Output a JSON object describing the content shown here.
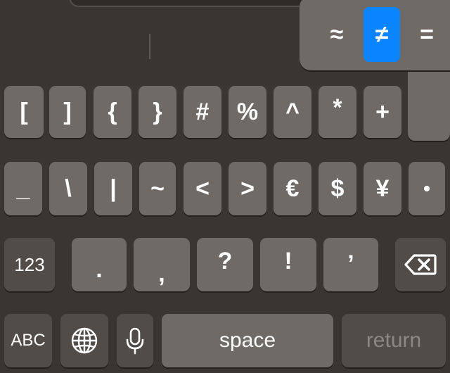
{
  "popup": {
    "items": [
      {
        "label": "≈",
        "selected": false
      },
      {
        "label": "≠",
        "selected": true
      },
      {
        "label": "=",
        "selected": false
      }
    ],
    "accent": "#0a84ff"
  },
  "rows": {
    "row1": [
      "[",
      "]",
      "{",
      "}",
      "#",
      "%",
      "^",
      "*",
      "+"
    ],
    "row2": [
      "_",
      "\\",
      "|",
      "~",
      "<",
      ">",
      "€",
      "$",
      "¥",
      "•"
    ],
    "row3": {
      "mode": "123",
      "keys": [
        ".",
        ",",
        "?",
        "!",
        "’"
      ]
    },
    "row4": {
      "abc": "ABC",
      "space": "space",
      "return": "return"
    }
  },
  "icons": {
    "delete": "delete-left-icon",
    "globe": "globe-icon",
    "mic": "microphone-icon"
  }
}
